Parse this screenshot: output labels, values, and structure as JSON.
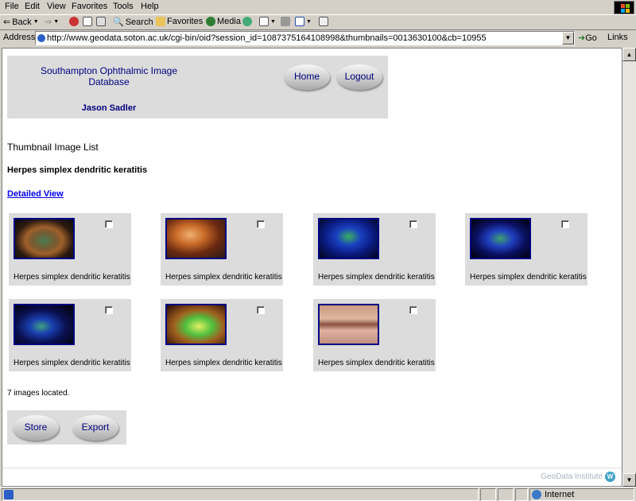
{
  "menu": [
    "File",
    "Edit",
    "View",
    "Favorites",
    "Tools",
    "Help"
  ],
  "toolbar": {
    "back": "Back",
    "search": "Search",
    "favorites": "Favorites",
    "media": "Media"
  },
  "address": {
    "label": "Address",
    "url": "http://www.geodata.soton.ac.uk/cgi-bin/oid?session_id=1087375164108998&thumbnails=0013630100&cb=10955",
    "go": "Go",
    "links": "Links"
  },
  "header": {
    "title": "Southampton Ophthalmic Image Database",
    "user": "Jason Sadler",
    "home_label": "Home",
    "logout_label": "Logout"
  },
  "page": {
    "heading": "Thumbnail Image List",
    "subheading": "Herpes simplex dendritic keratitis",
    "detailed_view": "Detailed View",
    "count_text": "7 images located."
  },
  "thumbnails": [
    {
      "caption": "Herpes simplex dendritic keratitis"
    },
    {
      "caption": "Herpes simplex dendritic keratitis"
    },
    {
      "caption": "Herpes simplex dendritic keratitis"
    },
    {
      "caption": "Herpes simplex dendritic keratitis"
    },
    {
      "caption": "Herpes simplex dendritic keratitis"
    },
    {
      "caption": "Herpes simplex dendritic keratitis"
    },
    {
      "caption": "Herpes simplex dendritic keratitis"
    }
  ],
  "actions": {
    "store_label": "Store",
    "export_label": "Export"
  },
  "footer": {
    "text": "GeoData Institute",
    "logo": "W"
  },
  "status": {
    "zone": "Internet"
  },
  "colors": {
    "brand_navy": "#000080",
    "panel_grey": "#dcdcdc",
    "link_blue": "#0000ee"
  }
}
